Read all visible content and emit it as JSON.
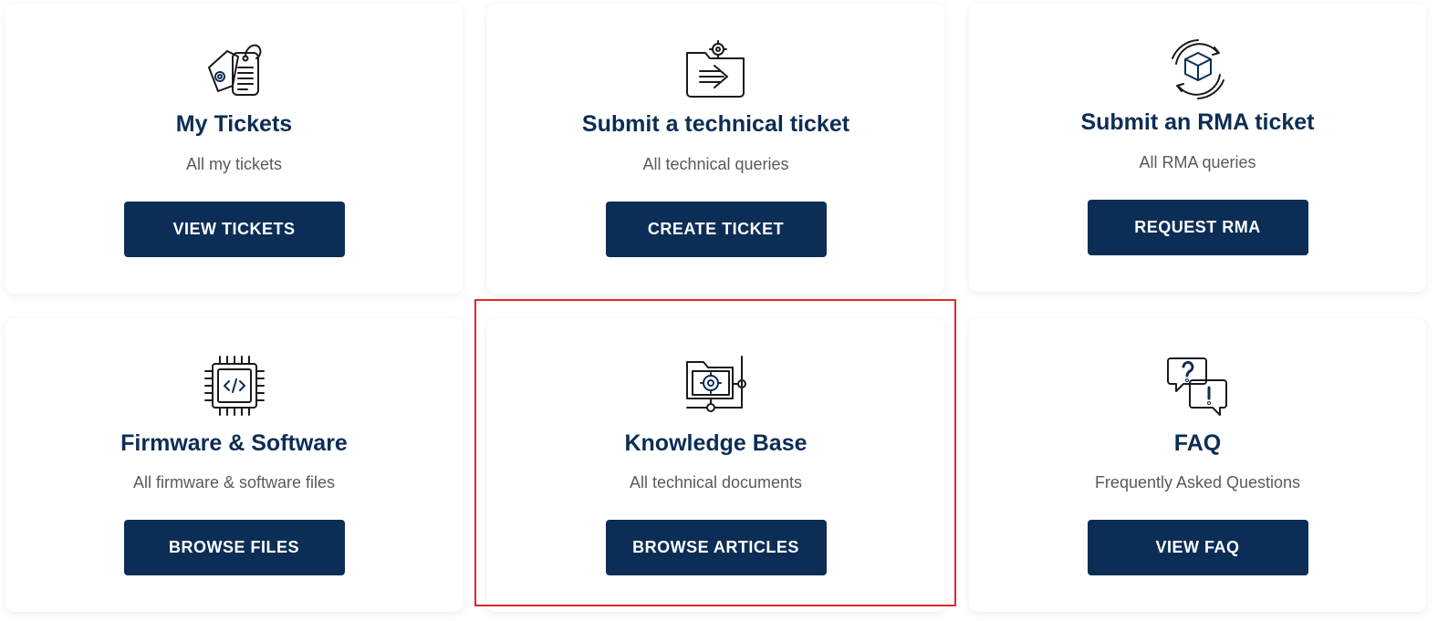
{
  "cards": [
    {
      "icon": "ticket-tags-icon",
      "title": "My Tickets",
      "subtitle": "All my tickets",
      "button": "VIEW TICKETS"
    },
    {
      "icon": "folder-send-gear-icon",
      "title": "Submit a technical ticket",
      "subtitle": "All technical queries",
      "button": "CREATE TICKET"
    },
    {
      "icon": "box-return-icon",
      "title": "Submit an RMA ticket",
      "subtitle": "All RMA queries",
      "button": "REQUEST RMA"
    },
    {
      "icon": "chip-code-icon",
      "title": "Firmware & Software",
      "subtitle": "All firmware & software files",
      "button": "BROWSE FILES"
    },
    {
      "icon": "folder-network-gear-icon",
      "title": "Knowledge Base",
      "subtitle": "All technical documents",
      "button": "BROWSE ARTICLES"
    },
    {
      "icon": "question-exclamation-bubbles-icon",
      "title": "FAQ",
      "subtitle": "Frequently Asked Questions",
      "button": "VIEW FAQ"
    }
  ],
  "colors": {
    "primary": "#0c2d55",
    "highlight": "#e0262b",
    "subtitle": "#5a5a5a"
  }
}
